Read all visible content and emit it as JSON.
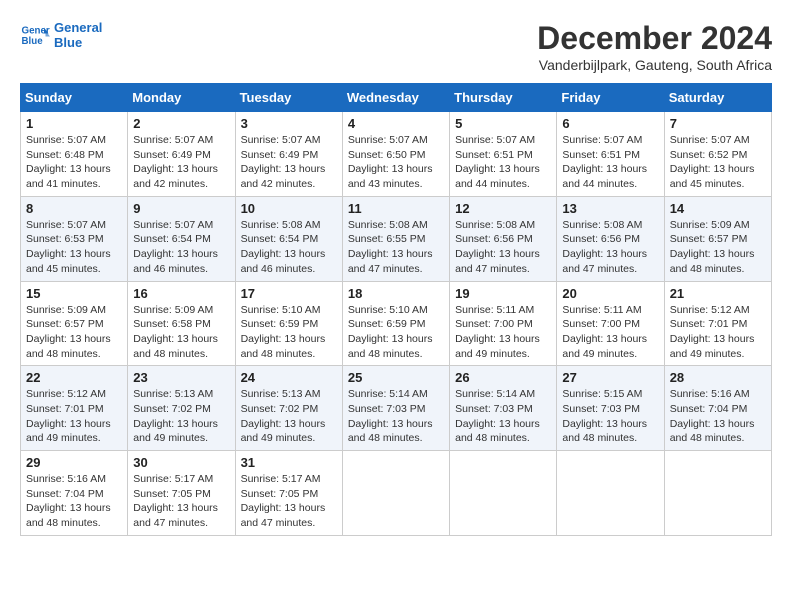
{
  "header": {
    "logo_line1": "General",
    "logo_line2": "Blue",
    "month": "December 2024",
    "location": "Vanderbijlpark, Gauteng, South Africa"
  },
  "weekdays": [
    "Sunday",
    "Monday",
    "Tuesday",
    "Wednesday",
    "Thursday",
    "Friday",
    "Saturday"
  ],
  "weeks": [
    [
      {
        "day": "1",
        "sunrise": "5:07 AM",
        "sunset": "6:48 PM",
        "daylight": "13 hours and 41 minutes."
      },
      {
        "day": "2",
        "sunrise": "5:07 AM",
        "sunset": "6:49 PM",
        "daylight": "13 hours and 42 minutes."
      },
      {
        "day": "3",
        "sunrise": "5:07 AM",
        "sunset": "6:49 PM",
        "daylight": "13 hours and 42 minutes."
      },
      {
        "day": "4",
        "sunrise": "5:07 AM",
        "sunset": "6:50 PM",
        "daylight": "13 hours and 43 minutes."
      },
      {
        "day": "5",
        "sunrise": "5:07 AM",
        "sunset": "6:51 PM",
        "daylight": "13 hours and 44 minutes."
      },
      {
        "day": "6",
        "sunrise": "5:07 AM",
        "sunset": "6:51 PM",
        "daylight": "13 hours and 44 minutes."
      },
      {
        "day": "7",
        "sunrise": "5:07 AM",
        "sunset": "6:52 PM",
        "daylight": "13 hours and 45 minutes."
      }
    ],
    [
      {
        "day": "8",
        "sunrise": "5:07 AM",
        "sunset": "6:53 PM",
        "daylight": "13 hours and 45 minutes."
      },
      {
        "day": "9",
        "sunrise": "5:07 AM",
        "sunset": "6:54 PM",
        "daylight": "13 hours and 46 minutes."
      },
      {
        "day": "10",
        "sunrise": "5:08 AM",
        "sunset": "6:54 PM",
        "daylight": "13 hours and 46 minutes."
      },
      {
        "day": "11",
        "sunrise": "5:08 AM",
        "sunset": "6:55 PM",
        "daylight": "13 hours and 47 minutes."
      },
      {
        "day": "12",
        "sunrise": "5:08 AM",
        "sunset": "6:56 PM",
        "daylight": "13 hours and 47 minutes."
      },
      {
        "day": "13",
        "sunrise": "5:08 AM",
        "sunset": "6:56 PM",
        "daylight": "13 hours and 47 minutes."
      },
      {
        "day": "14",
        "sunrise": "5:09 AM",
        "sunset": "6:57 PM",
        "daylight": "13 hours and 48 minutes."
      }
    ],
    [
      {
        "day": "15",
        "sunrise": "5:09 AM",
        "sunset": "6:57 PM",
        "daylight": "13 hours and 48 minutes."
      },
      {
        "day": "16",
        "sunrise": "5:09 AM",
        "sunset": "6:58 PM",
        "daylight": "13 hours and 48 minutes."
      },
      {
        "day": "17",
        "sunrise": "5:10 AM",
        "sunset": "6:59 PM",
        "daylight": "13 hours and 48 minutes."
      },
      {
        "day": "18",
        "sunrise": "5:10 AM",
        "sunset": "6:59 PM",
        "daylight": "13 hours and 48 minutes."
      },
      {
        "day": "19",
        "sunrise": "5:11 AM",
        "sunset": "7:00 PM",
        "daylight": "13 hours and 49 minutes."
      },
      {
        "day": "20",
        "sunrise": "5:11 AM",
        "sunset": "7:00 PM",
        "daylight": "13 hours and 49 minutes."
      },
      {
        "day": "21",
        "sunrise": "5:12 AM",
        "sunset": "7:01 PM",
        "daylight": "13 hours and 49 minutes."
      }
    ],
    [
      {
        "day": "22",
        "sunrise": "5:12 AM",
        "sunset": "7:01 PM",
        "daylight": "13 hours and 49 minutes."
      },
      {
        "day": "23",
        "sunrise": "5:13 AM",
        "sunset": "7:02 PM",
        "daylight": "13 hours and 49 minutes."
      },
      {
        "day": "24",
        "sunrise": "5:13 AM",
        "sunset": "7:02 PM",
        "daylight": "13 hours and 49 minutes."
      },
      {
        "day": "25",
        "sunrise": "5:14 AM",
        "sunset": "7:03 PM",
        "daylight": "13 hours and 48 minutes."
      },
      {
        "day": "26",
        "sunrise": "5:14 AM",
        "sunset": "7:03 PM",
        "daylight": "13 hours and 48 minutes."
      },
      {
        "day": "27",
        "sunrise": "5:15 AM",
        "sunset": "7:03 PM",
        "daylight": "13 hours and 48 minutes."
      },
      {
        "day": "28",
        "sunrise": "5:16 AM",
        "sunset": "7:04 PM",
        "daylight": "13 hours and 48 minutes."
      }
    ],
    [
      {
        "day": "29",
        "sunrise": "5:16 AM",
        "sunset": "7:04 PM",
        "daylight": "13 hours and 48 minutes."
      },
      {
        "day": "30",
        "sunrise": "5:17 AM",
        "sunset": "7:05 PM",
        "daylight": "13 hours and 47 minutes."
      },
      {
        "day": "31",
        "sunrise": "5:17 AM",
        "sunset": "7:05 PM",
        "daylight": "13 hours and 47 minutes."
      },
      null,
      null,
      null,
      null
    ]
  ],
  "labels": {
    "sunrise": "Sunrise:",
    "sunset": "Sunset:",
    "daylight": "Daylight:"
  }
}
